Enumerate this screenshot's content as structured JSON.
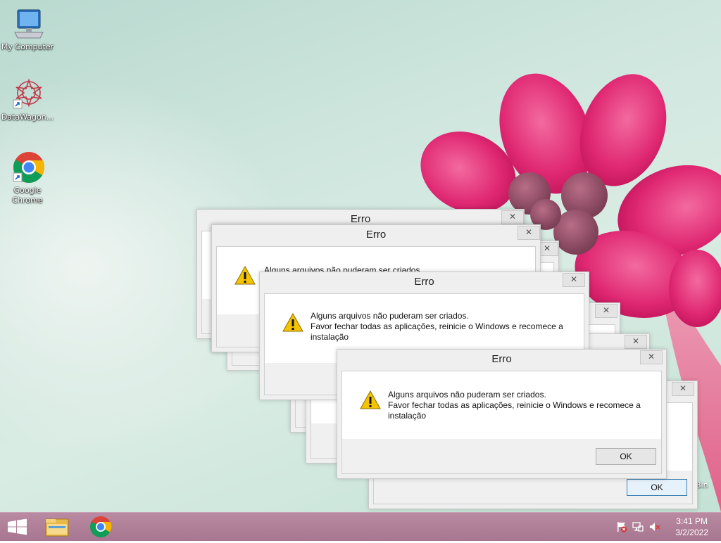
{
  "desktop": {
    "icons": [
      {
        "label": "My Computer",
        "icon": "computer-icon"
      },
      {
        "label": "DataWagon...",
        "icon": "datawagon-icon"
      },
      {
        "label": "Google Chrome",
        "icon": "chrome-icon"
      }
    ],
    "recycle_partial_label": "Bin"
  },
  "dialog": {
    "title": "Erro",
    "close_glyph": "✕",
    "line1": "Alguns arquivos não puderam ser criados.",
    "line2": "Favor fechar todas as aplicações, reinicie o Windows e recomece a",
    "line3": "instalação",
    "partial_line": "Alguns arquivos não puderam ser criados",
    "ok_label": "OK"
  },
  "taskbar": {
    "pinned": [
      "start-button",
      "file-explorer-icon",
      "chrome-icon"
    ],
    "tray": [
      "action-center-flag-icon",
      "network-icon",
      "volume-muted-icon"
    ],
    "time": "3:41 PM",
    "date": "3/2/2022"
  },
  "colors": {
    "taskbar": "#a77690",
    "flower": "#e0357a",
    "warning": "#f5c400"
  }
}
